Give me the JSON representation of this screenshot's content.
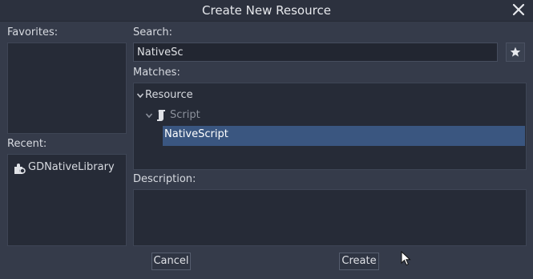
{
  "dialog": {
    "title": "Create New Resource"
  },
  "favorites": {
    "label": "Favorites:"
  },
  "recent": {
    "label": "Recent:",
    "items": [
      {
        "label": "GDNativeLibrary",
        "icon": "gdnative-plugin-icon"
      }
    ]
  },
  "search": {
    "label": "Search:",
    "value": "NativeSc",
    "favorite_icon": "star-icon"
  },
  "matches": {
    "label": "Matches:",
    "tree": [
      {
        "label": "Resource",
        "icon": "chevron-down-icon"
      },
      {
        "label": "Script",
        "icon": "script-icon"
      },
      {
        "label": "NativeScript",
        "selected": true
      }
    ]
  },
  "description": {
    "label": "Description:"
  },
  "buttons": {
    "cancel": "Cancel",
    "create": "Create"
  },
  "colors": {
    "background": "#353b4a",
    "panel": "#262b37",
    "selection": "#3a5680",
    "muted_text": "#8b909b"
  }
}
